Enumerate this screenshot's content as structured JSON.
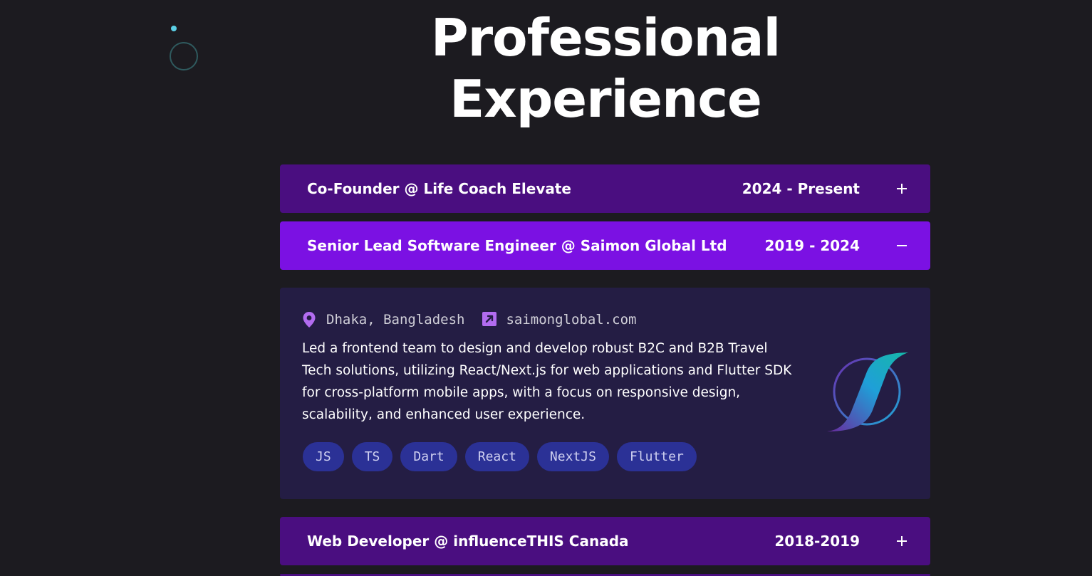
{
  "page": {
    "title_line1": "Professional",
    "title_line2": "Experience"
  },
  "experiences": [
    {
      "title": "Co-Founder @ Life Coach Elevate",
      "dates": "2024 - Present",
      "state": "collapsed",
      "toggle_icon": "plus-icon"
    },
    {
      "title": "Senior Lead Software Engineer @ Saimon Global Ltd",
      "dates": "2019 - 2024",
      "state": "expanded",
      "toggle_icon": "minus-icon",
      "location": "Dhaka, Bangladesh",
      "website": "saimonglobal.com",
      "description": "Led a frontend team to design and develop robust B2C and B2B Travel Tech solutions, utilizing React/Next.js for web applications and Flutter SDK for cross-platform mobile apps, with a focus on responsive design, scalability, and enhanced user experience.",
      "tags": [
        "JS",
        "TS",
        "Dart",
        "React",
        "NextJS",
        "Flutter"
      ]
    },
    {
      "title": "Web Developer @ influenceTHIS Canada",
      "dates": "2018-2019",
      "state": "collapsed",
      "toggle_icon": "plus-icon"
    }
  ],
  "colors": {
    "background": "#1c1b20",
    "header_collapsed": "#4a0e80",
    "header_expanded": "#7b11e3",
    "body_panel": "#241d44",
    "tag_bg": "#2b3196",
    "icon_accent": "#b26cf0"
  }
}
